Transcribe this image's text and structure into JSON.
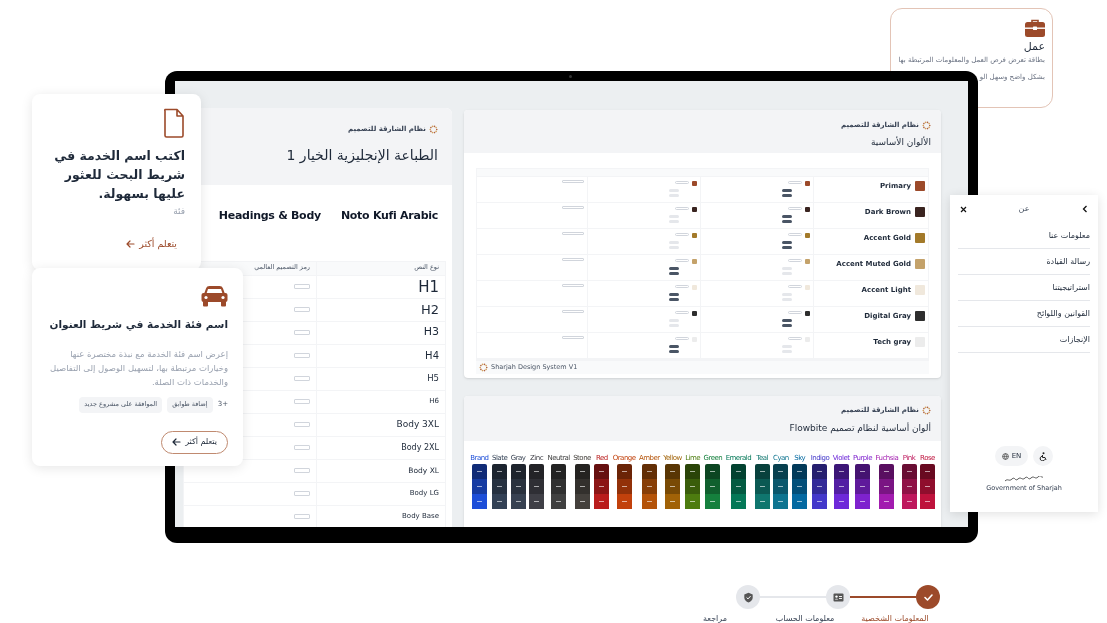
{
  "job_card": {
    "title": "عمل",
    "description_lines": [
      "بطاقة تعرض فرص العمل والمعلومات المرتبطة بها",
      "بشكل واضح وسهل الو"
    ]
  },
  "search_card": {
    "title": "اكتب اسم الخدمة في شريط البحث للعثور عليها بسهولة.",
    "category": "فئة",
    "link": "يتعلم أكثر"
  },
  "category_card": {
    "title": "اسم فئة الخدمة في شريط العنوان",
    "description": "إعرض اسم فئة الخدمة مع نبذة مختصرة عنها وخيارات مرتبطة بها، لتسهيل الوصول إلى التفاصيل والخدمات ذات الصلة.",
    "tags": [
      {
        "label": "+3",
        "kind": "count"
      },
      {
        "label": "إضافة طوابق",
        "kind": "tag"
      },
      {
        "label": "الموافقة على مشروع جديد",
        "kind": "tag"
      }
    ],
    "button": "يتعلم أكثر"
  },
  "typography_doc": {
    "brand": "نظام الشارقة للتصميم",
    "title": "الطباعة الإنجليزية الخيار 1",
    "fonts": [
      "Noto Kufi Arabic",
      "Headings & Body"
    ],
    "columns": [
      "نوع النص",
      "رمز التصميم العالمي"
    ],
    "rows": [
      {
        "label": "H1"
      },
      {
        "label": "H2"
      },
      {
        "label": "H3"
      },
      {
        "label": "H4"
      },
      {
        "label": "H5"
      },
      {
        "label": "H6"
      },
      {
        "label": "Body 3XL"
      },
      {
        "label": "Body 2XL"
      },
      {
        "label": "Body XL"
      },
      {
        "label": "Body LG"
      },
      {
        "label": "Body Base"
      }
    ]
  },
  "colors_doc": {
    "brand": "نظام الشارقة للتصميم",
    "title": "الألوان الأساسية",
    "rows": [
      {
        "name": "Primary",
        "color": "#9c4a2a"
      },
      {
        "name": "Dark Brown",
        "color": "#3a2420"
      },
      {
        "name": "Accent Gold",
        "color": "#a37a2a"
      },
      {
        "name": "Accent Muted Gold",
        "color": "#c4a26a"
      },
      {
        "name": "Accent Light",
        "color": "#f0e8dc"
      },
      {
        "name": "Digital Gray",
        "color": "#2e2e2e"
      },
      {
        "name": "Tech gray",
        "color": "#ececec"
      }
    ],
    "footer": "Sharjah Design System V1"
  },
  "palette_doc": {
    "brand": "نظام الشارقة للتصميم",
    "title": "ألوان أساسية لنظام تصميم Flowbite",
    "palettes": [
      {
        "label": "Rose",
        "color": "#be123c"
      },
      {
        "label": "Pink",
        "color": "#be185d"
      },
      {
        "label": "Fuchsia",
        "color": "#a21caf"
      },
      {
        "label": "Purple",
        "color": "#7e22ce"
      },
      {
        "label": "Violet",
        "color": "#6d28d9"
      },
      {
        "label": "Indigo",
        "color": "#4338ca"
      },
      {
        "label": "Sky",
        "color": "#0369a1"
      },
      {
        "label": "Cyan",
        "color": "#0e7490"
      },
      {
        "label": "Teal",
        "color": "#0f766e"
      },
      {
        "label": "Emerald",
        "color": "#047857"
      },
      {
        "label": "Green",
        "color": "#15803d"
      },
      {
        "label": "Lime",
        "color": "#4d7c0f"
      },
      {
        "label": "Yellow",
        "color": "#a16207"
      },
      {
        "label": "Amber",
        "color": "#b45309"
      },
      {
        "label": "Orange",
        "color": "#c2410c"
      },
      {
        "label": "Red",
        "color": "#b91c1c"
      },
      {
        "label": "Stone",
        "color": "#44403c"
      },
      {
        "label": "Neutral",
        "color": "#404040"
      },
      {
        "label": "Zinc",
        "color": "#3f3f46"
      },
      {
        "label": "Gray",
        "color": "#374151"
      },
      {
        "label": "Slate",
        "color": "#334155"
      },
      {
        "label": "Brand",
        "color": "#1d4ed8"
      }
    ]
  },
  "side_menu": {
    "title": "عن",
    "items": [
      "معلومات عنا",
      "رسالة القيادة",
      "استراتيجيتنا",
      "القوانين واللوائح",
      "الإنجازات"
    ],
    "language": "EN",
    "logo_text": "Government of Sharjah"
  },
  "stepper": {
    "steps": [
      {
        "label": "المعلومات الشخصية",
        "completed": true
      },
      {
        "label": "معلومات الحساب",
        "completed": false
      },
      {
        "label": "مراجعة",
        "completed": false
      }
    ]
  }
}
